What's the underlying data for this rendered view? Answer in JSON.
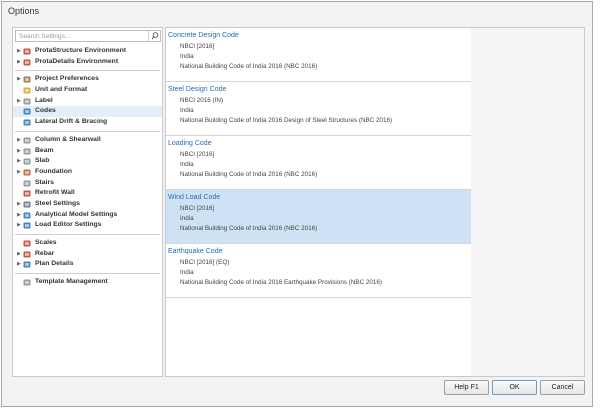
{
  "window": {
    "title": "Options"
  },
  "search": {
    "placeholder": "Search Settings..."
  },
  "sidebar": {
    "groups": [
      [
        {
          "label": "ProtaStructure Environment",
          "expandable": true,
          "icon": "prota-structure-icon"
        },
        {
          "label": "ProtaDetails Environment",
          "expandable": true,
          "icon": "prota-details-icon"
        }
      ],
      [
        {
          "label": "Project Preferences",
          "expandable": true,
          "icon": "folder-icon"
        },
        {
          "label": "Unit and Format",
          "expandable": false,
          "icon": "units-icon"
        },
        {
          "label": "Label",
          "expandable": true,
          "icon": "label-icon"
        },
        {
          "label": "Codes",
          "expandable": false,
          "icon": "codes-icon",
          "selected": true
        },
        {
          "label": "Lateral Drift & Bracing",
          "expandable": false,
          "icon": "bracing-icon"
        }
      ],
      [
        {
          "label": "Column & Shearwall",
          "expandable": true,
          "icon": "column-icon"
        },
        {
          "label": "Beam",
          "expandable": true,
          "icon": "beam-icon"
        },
        {
          "label": "Slab",
          "expandable": true,
          "icon": "slab-icon"
        },
        {
          "label": "Foundation",
          "expandable": true,
          "icon": "foundation-icon"
        },
        {
          "label": "Stairs",
          "expandable": false,
          "icon": "stairs-icon"
        },
        {
          "label": "Retrofit Wall",
          "expandable": false,
          "icon": "wall-icon"
        },
        {
          "label": "Steel Settings",
          "expandable": true,
          "icon": "steel-icon"
        },
        {
          "label": "Analytical Model Settings",
          "expandable": true,
          "icon": "analytical-icon"
        },
        {
          "label": "Load Editor Settings",
          "expandable": true,
          "icon": "load-editor-icon"
        }
      ],
      [
        {
          "label": "Scales",
          "expandable": false,
          "icon": "scales-icon"
        },
        {
          "label": "Rebar",
          "expandable": true,
          "icon": "rebar-icon"
        },
        {
          "label": "Plan Details",
          "expandable": true,
          "icon": "plan-details-icon"
        }
      ],
      [
        {
          "label": "Template Management",
          "expandable": false,
          "icon": "template-icon"
        }
      ]
    ]
  },
  "codes": [
    {
      "title": "Concrete Design Code",
      "lines": [
        "NBCI [2016]",
        "India",
        "National Building Code of India 2016 (NBC 2016)"
      ]
    },
    {
      "title": "Steel Design Code",
      "lines": [
        "NBCI 2016 (IN)",
        "India",
        "National Building Code of India 2016 Design of Steel Structures (NBC 2016)"
      ]
    },
    {
      "title": "Loading Code",
      "lines": [
        "NBCI [2016]",
        "India",
        "National Building Code of India 2016 (NBC 2016)"
      ]
    },
    {
      "title": "Wind Load Code",
      "lines": [
        "NBCI [2016]",
        "India",
        "National Building Code of India 2016 (NBC 2016)"
      ],
      "selected": true
    },
    {
      "title": "Earthquake Code",
      "lines": [
        "NBCI [2016] (EQ)",
        "India",
        "National Building Code of India 2016 Earthquake Provisions (NBC 2016)"
      ]
    }
  ],
  "footer": {
    "help_label": "Help  F1",
    "ok_label": "OK",
    "cancel_label": "Cancel"
  },
  "colors": {
    "accent": "#2b6db2",
    "selection": "#cde3f5"
  }
}
